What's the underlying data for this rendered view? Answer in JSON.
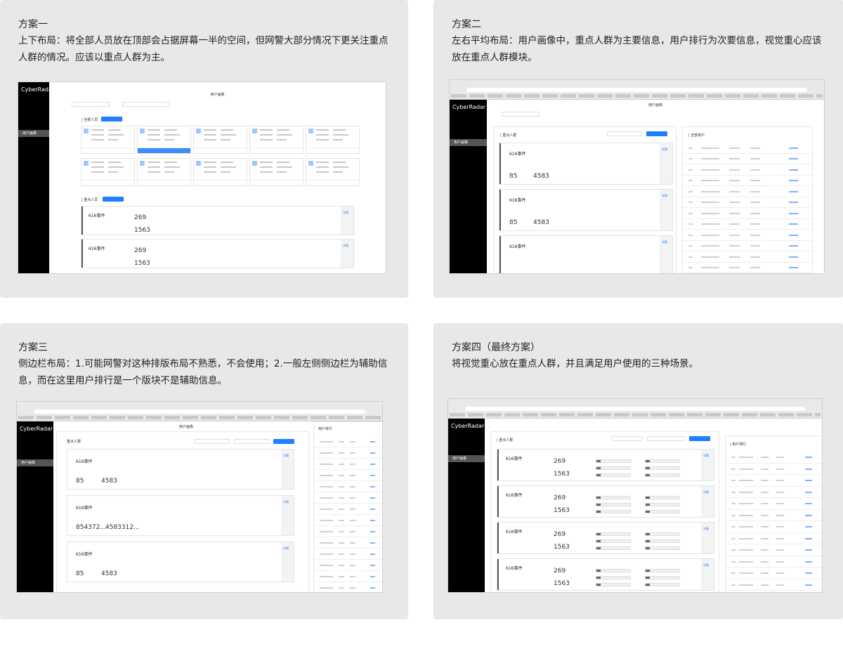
{
  "cards": [
    {
      "title": "方案一",
      "desc": "上下布局：将全部人员放在顶部会占据屏幕一半的空间，但网警大部分情况下更关注重点人群的情况。应该以重点人群为主。",
      "shot": {
        "logo": "CyberRadar",
        "nav": "用户画像",
        "header": "用户画像",
        "section_all": "| 全部人员",
        "section_key": "| 重点人员",
        "event": "616事件",
        "nums": [
          "269",
          "1563"
        ]
      }
    },
    {
      "title": "方案二",
      "desc": "左右平均布局：用户画像中，重点人群为主要信息，用户排行为次要信息，视觉重心应该放在重点人群模块。",
      "shot": {
        "logo": "CyberRadar",
        "nav": "用户画像",
        "header": "用户画像",
        "left_title": "| 重点人群",
        "right_title": "| 全部用户",
        "event": "616事件",
        "nums": [
          "85",
          "4583"
        ]
      }
    },
    {
      "title": "方案三",
      "desc": "侧边栏布局：1.可能网警对这种排版布局不熟悉，不会使用；2.一般左侧侧边栏为辅助信息，而在这里用户排行是一个版块不是辅助信息。",
      "shot": {
        "logo": "CyberRadar",
        "nav": "用户画像",
        "header": "用户画像",
        "left_title": "重点人群",
        "right_title": "用户排行",
        "event": "616事件",
        "nums": [
          "85",
          "4583",
          "854372...",
          "4583312..."
        ]
      }
    },
    {
      "title": "方案四（最终方案）",
      "desc": "将视觉重心放在重点人群，并且满足用户使用的三种场景。",
      "shot": {
        "logo": "CyberRadar",
        "nav": "用户画像",
        "header": "用户画像",
        "left_title": "| 重点人群",
        "right_title": "| 用户排行",
        "event": "616事件",
        "nums": [
          "269",
          "1563"
        ]
      }
    }
  ]
}
